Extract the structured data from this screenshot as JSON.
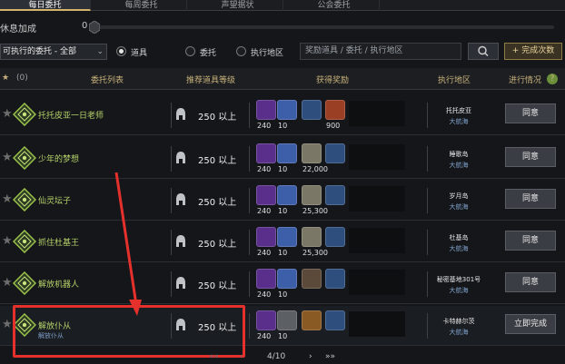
{
  "tabs": [
    {
      "label": "每日委托",
      "active": true
    },
    {
      "label": "每周委托",
      "active": false
    },
    {
      "label": "声望据状",
      "active": false
    },
    {
      "label": "公会委托",
      "active": false
    }
  ],
  "rest": {
    "label": "休息加成",
    "value": "0"
  },
  "filters": {
    "select_value": "可执行的委托 - 全部",
    "radio_items": [
      {
        "label": "道具",
        "selected": true
      },
      {
        "label": "委托",
        "selected": false
      },
      {
        "label": "执行地区",
        "selected": false
      }
    ],
    "search_placeholder": "奖励道具 / 委托 / 执行地区",
    "complete_label": "+ 完成次数"
  },
  "header": {
    "fav_count": "(0)",
    "col_list": "委托列表",
    "col_level": "推荐道具等级",
    "col_reward": "获得奖励",
    "col_region": "执行地区",
    "col_status": "进行情况"
  },
  "rows": [
    {
      "name": "托托皮亚一日老师",
      "sub": "",
      "level": "250 以上",
      "rewards": [
        "240",
        "10",
        "",
        "900"
      ],
      "place": "托托皮亚",
      "sea": "大航海",
      "action": "同意"
    },
    {
      "name": "少年的梦想",
      "sub": "",
      "level": "250 以上",
      "rewards": [
        "240",
        "10",
        "22,000",
        ""
      ],
      "place": "睡歌岛",
      "sea": "大航海",
      "action": "同意"
    },
    {
      "name": "仙灵坛子",
      "sub": "",
      "level": "250 以上",
      "rewards": [
        "240",
        "10",
        "25,300",
        ""
      ],
      "place": "岁月岛",
      "sea": "大航海",
      "action": "同意"
    },
    {
      "name": "抓住杜基王",
      "sub": "",
      "level": "250 以上",
      "rewards": [
        "240",
        "10",
        "25,300",
        ""
      ],
      "place": "杜基岛",
      "sea": "大航海",
      "action": "同意"
    },
    {
      "name": "解放机器人",
      "sub": "",
      "level": "250 以上",
      "rewards": [
        "240",
        "10",
        "",
        ""
      ],
      "place": "秘密基地301号",
      "sea": "大航海",
      "action": "同意"
    },
    {
      "name": "解放仆从",
      "sub": "解放仆从",
      "level": "250 以上",
      "rewards": [
        "240",
        "10",
        "",
        ""
      ],
      "place": "卡特赫尔茨",
      "sea": "大航海",
      "action": "立即完成"
    }
  ],
  "pager": {
    "page": "4/10"
  },
  "colors": {
    "accent_gold": "#d6b36a",
    "quest_green": "#b7d36a",
    "highlight_red": "#e5302c"
  }
}
